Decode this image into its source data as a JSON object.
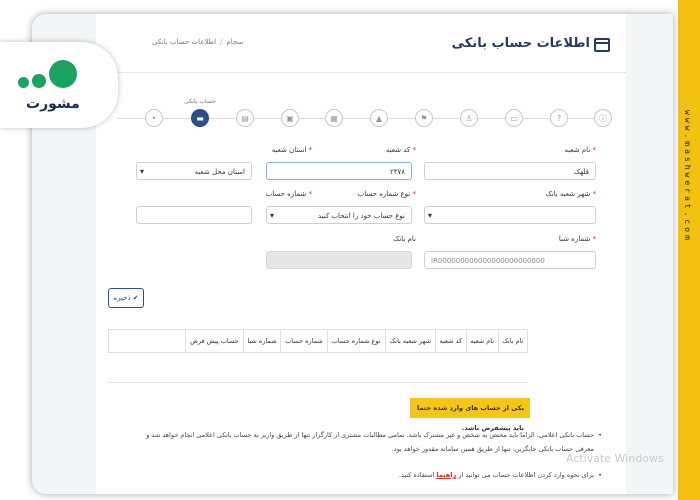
{
  "header": {
    "title": "اطلاعات حساب بانکی",
    "breadcrumb": [
      "اطلاعات حساب بانکی",
      "/",
      "سجام"
    ]
  },
  "steps": {
    "active_label": "حساب بانکی",
    "icons": [
      "info-circle-icon",
      "question-icon",
      "id-card-icon",
      "person-icon",
      "bookmark-icon",
      "graduation-cap-icon",
      "calendar-icon",
      "briefcase-icon",
      "money-icon",
      "bank-card-icon",
      "more-icon"
    ]
  },
  "form": {
    "branch_name": {
      "label": "نام شعبه",
      "value": "قلهک"
    },
    "branch_code": {
      "label": "کد شعبه",
      "value": "۲۴۷۸"
    },
    "branch_province": {
      "label": "استان شعبه",
      "value": "استان محل شعبه"
    },
    "branch_city": {
      "label": "شهر شعبه بانک",
      "value": ""
    },
    "account_type": {
      "label": "نوع شماره حساب",
      "value": "نوع حساب خود را انتخاب کنید"
    },
    "account_number": {
      "label": "شماره حساب",
      "value": ""
    },
    "sheba": {
      "label": "شماره شبا",
      "value": "IR000000000000000000000000"
    },
    "bank_name": {
      "label": "نام بانک",
      "value": ""
    },
    "save_label": "ذخیره"
  },
  "table": {
    "headers": [
      "نام بانک",
      "نام شعبه",
      "کد شعبه",
      "شهر شعبه بانک",
      "نوع شماره حساب",
      "شماره حساب",
      "شماره شبا",
      "حساب پیش فرض",
      ""
    ]
  },
  "notes": {
    "highlight": "یکی از حساب های وارد شده حتما باید پیشفرض باشد.",
    "bullet1": "حساب بانکی اعلامی، الزاما باید مختص به شخص و غیر مشترک باشد. تمامی مطالبات مشتری از کارگزار تنها از طریق واریز به حساب بانکی اعلامی انجام خواهد شد و معرفی حساب بانکی جایگزین، تنها از طریق همین سامانه مقدور خواهد بود.",
    "bullet2_pre": "برای نحوه وارد کردن اطلاعات حساب می توانید از",
    "help_link": "راهنما",
    "bullet2_post": "استفاده کنید."
  },
  "watermark": "Activate Windows",
  "brand": {
    "logo_text": "مشورت",
    "site": "www.mashwerat.com"
  },
  "colors": {
    "primary": "#2a4f8a",
    "highlight": "#f5c518",
    "brand_green": "#1aa260",
    "edge": "#f3c10f"
  }
}
